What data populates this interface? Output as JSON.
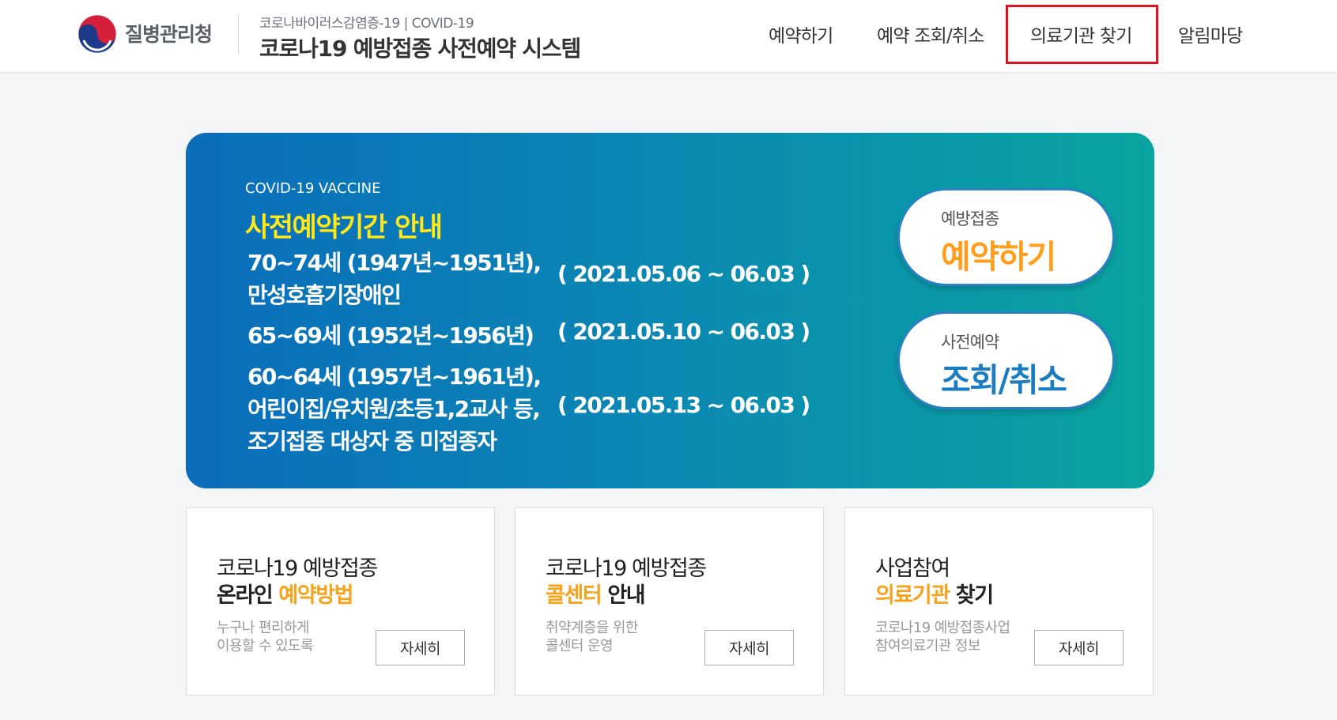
{
  "header": {
    "org_name": "질병관리청",
    "subtitle": "코로나바이러스감염증-19 | COVID-19",
    "title": "코로나19 예방접종 사전예약 시스템",
    "nav": [
      {
        "label": "예약하기"
      },
      {
        "label": "예약 조회/취소"
      },
      {
        "label": "의료기관 찾기",
        "highlighted": true
      },
      {
        "label": "알림마당"
      }
    ]
  },
  "banner": {
    "kicker": "COVID-19 VACCINE",
    "title": "사전예약기간 안내",
    "groups": [
      {
        "line1": "70~74세 (1947년~1951년),",
        "line2": "만성호흡기장애인",
        "period": "( 2021.05.06 ~ 06.03 )"
      },
      {
        "line1": "65~69세 (1952년~1956년)",
        "period": "( 2021.05.10 ~ 06.03 )"
      },
      {
        "line1": "60~64세 (1957년~1961년),",
        "line2": "어린이집/유치원/초등1,2교사 등,",
        "line3": "조기접종 대상자 중 미접종자",
        "period": "( 2021.05.13 ~ 06.03 )"
      }
    ],
    "buttons": {
      "reserve": {
        "small": "예방접종",
        "big": "예약하기"
      },
      "lookup": {
        "small": "사전예약",
        "big": "조회/취소"
      }
    }
  },
  "cards": [
    {
      "title1": "코로나19 예방접종",
      "title2_dark": "온라인 ",
      "title2_gold": "예약방법",
      "desc1": "누구나 편리하게",
      "desc2": "이용할 수 있도록",
      "button": "자세히"
    },
    {
      "title1": "코로나19 예방접종",
      "title2_gold": "콜센터",
      "title2_dark": " 안내",
      "desc1": "취약계층을 위한",
      "desc2": "콜센터 운영",
      "button": "자세히"
    },
    {
      "title1": "사업참여",
      "title2_gold": "의료기관",
      "title2_dark": " 찾기",
      "desc1": "코로나19 예방접종사업",
      "desc2": "참여의료기관 정보",
      "button": "자세히"
    }
  ],
  "colors": {
    "banner_start": "#0a6dbb",
    "banner_end": "#0aa5a0",
    "title_yellow": "#ffe81a",
    "accent_orange": "#ff9e1b",
    "accent_blue": "#1a7dc2",
    "highlight_red": "#e0121f"
  },
  "icons": {
    "logo": "taegeuk-logo-icon"
  }
}
